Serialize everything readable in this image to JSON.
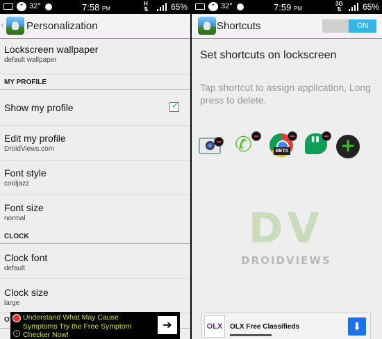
{
  "left": {
    "status": {
      "temperature": "32°",
      "time": "7:58",
      "ampm": "PM",
      "network": "H",
      "battery": "65%"
    },
    "title": "Personalization",
    "items": [
      {
        "title": "Lockscreen wallpaper",
        "subtitle": "default wallpaper"
      },
      {
        "category": "MY PROFILE"
      },
      {
        "title": "Show my profile",
        "checked": true
      },
      {
        "title": "Edit my profile",
        "subtitle": "DroidViews.com"
      },
      {
        "title": "Font style",
        "subtitle": "cooljazz"
      },
      {
        "title": "Font size",
        "subtitle": "normal"
      },
      {
        "category": "CLOCK"
      },
      {
        "title": "Clock font",
        "subtitle": "default"
      },
      {
        "title": "Clock size",
        "subtitle": "large"
      }
    ],
    "partial_category": "OT",
    "ad": {
      "text": "Understand What May Cause Symptoms Try the Free Symptom Checker Now!",
      "button_icon": "arrow-right-icon"
    }
  },
  "right": {
    "status": {
      "temperature": "32°",
      "time": "7:59",
      "ampm": "PM",
      "network": "3G",
      "battery": "65%"
    },
    "title": "Shortcuts",
    "toggle_label": "ON",
    "heading": "Set shortcuts on lockscreen",
    "hint": "Tap shortcut to assign application, Long press to delete.",
    "shortcuts": [
      "camera-icon",
      "phone-icon",
      "chrome-beta-icon",
      "hangouts-icon"
    ],
    "chrome_badge": "BETA",
    "add_icon": "add-icon",
    "watermark": {
      "logo": "DV",
      "text": "DROIDVIEWS"
    },
    "ad": {
      "logo": "OLX",
      "title": "OLX Free Classifieds",
      "button_icon": "download-icon"
    }
  },
  "colors": {
    "accent": "#33b5e5",
    "background": "#eeeeee",
    "statusbar": "#000000",
    "ad_text": "#cfe61c"
  }
}
